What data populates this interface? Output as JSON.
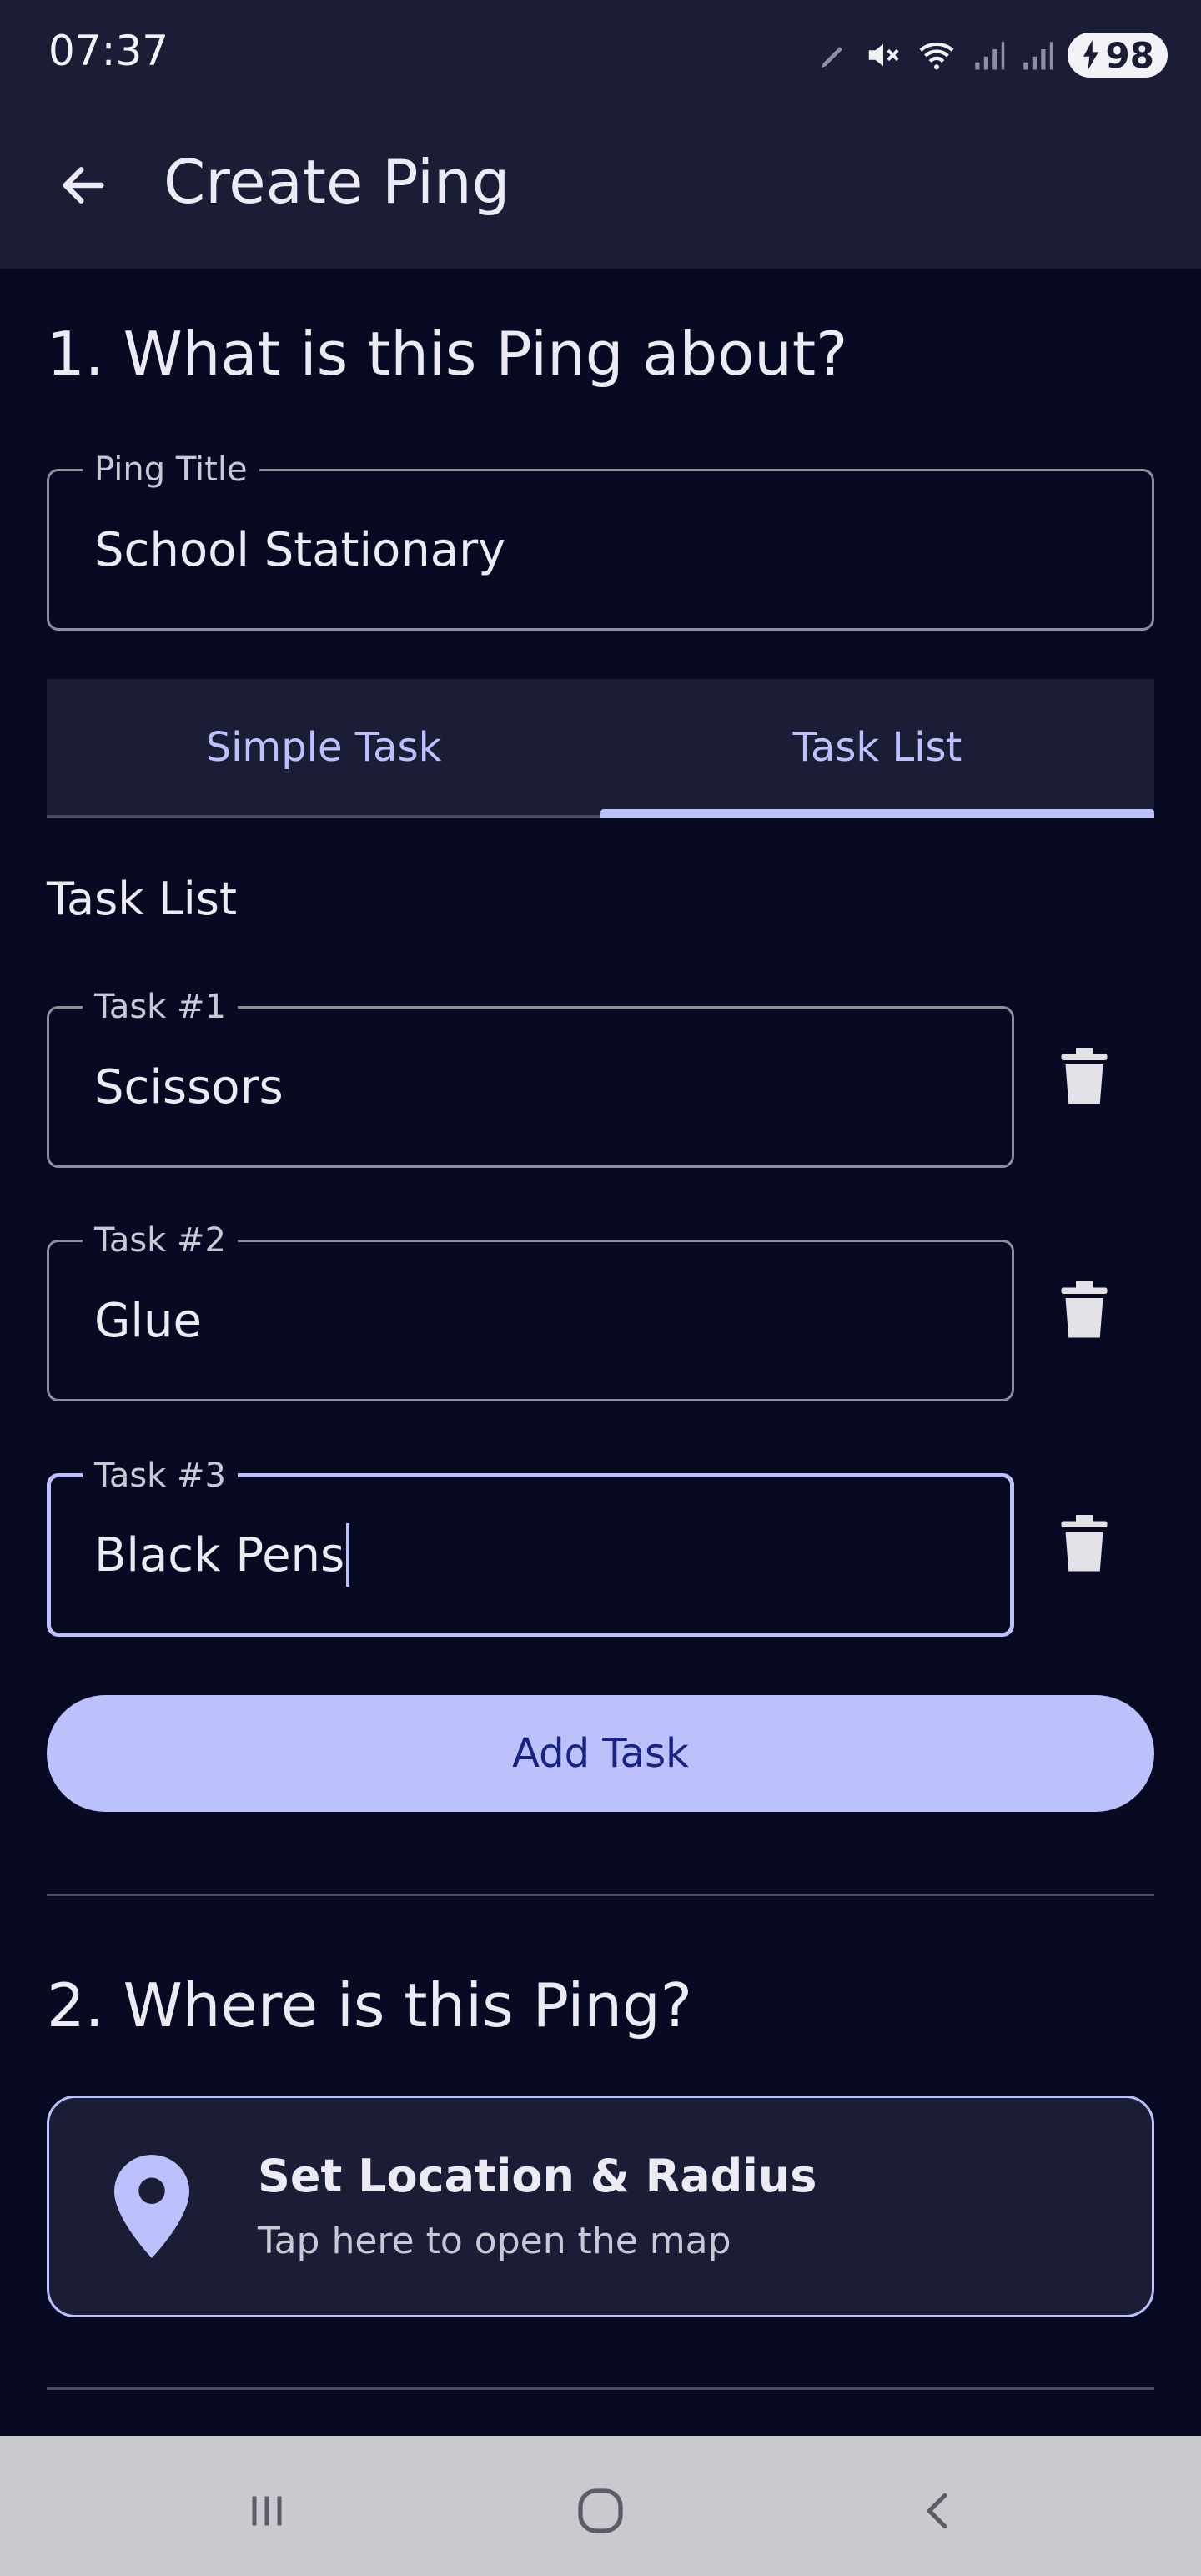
{
  "status": {
    "time": "07:37",
    "battery": "98",
    "icons": [
      "pencil-icon",
      "mute-icon",
      "wifi-icon",
      "signal-icon",
      "signal-icon",
      "battery-charging-icon"
    ]
  },
  "appbar": {
    "title": "Create Ping",
    "back_icon": "arrow-back-icon"
  },
  "section1": {
    "title": "1. What is this Ping about?",
    "ping_title": {
      "label": "Ping Title",
      "value": "School Stationary"
    },
    "tabs": [
      {
        "label": "Simple Task",
        "active": false
      },
      {
        "label": "Task List",
        "active": true
      }
    ],
    "task_list_label": "Task List",
    "tasks": [
      {
        "label": "Task #1",
        "value": "Scissors"
      },
      {
        "label": "Task #2",
        "value": "Glue"
      },
      {
        "label": "Task #3",
        "value": "Black Pens"
      }
    ],
    "add_task_label": "Add Task"
  },
  "section2": {
    "title": "2. Where is this Ping?",
    "location_card": {
      "title": "Set Location & Radius",
      "subtitle": "Tap here to open the map",
      "icon": "location-pin-icon"
    }
  },
  "colors": {
    "background": "#080a24",
    "surface": "#1b1c36",
    "accent": "#bcc0fb",
    "on_accent": "#1a237e",
    "outline": "#8d8d9c"
  },
  "navbar": {
    "icons": [
      "recent-apps-icon",
      "home-icon",
      "back-icon"
    ]
  }
}
